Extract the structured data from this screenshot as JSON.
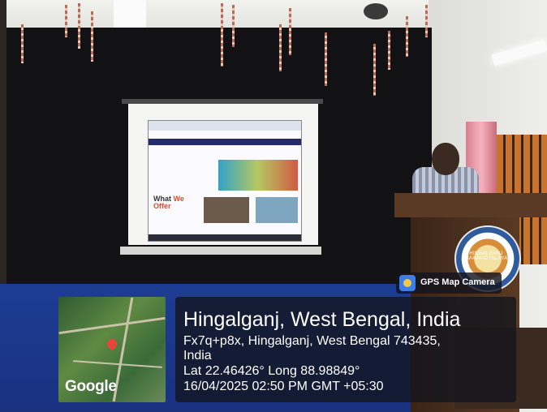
{
  "gps_overlay": {
    "badge_label": "GPS Map Camera",
    "map_provider": "Google",
    "location_title": "Hingalganj, West Bengal, India",
    "address_line_1": "Fx7q+p8x, Hingalganj, West Bengal 743435,",
    "address_line_2": "India",
    "coordinates": "Lat 22.46426° Long 88.98849°",
    "datetime": "16/04/2025 02:50 PM GMT +05:30"
  },
  "projected_slide": {
    "heading_plain": "What",
    "heading_accent": "We",
    "heading_line2": "Offer"
  },
  "podium": {
    "emblem_text": "HINGALGANJ MAHAVIDYALAYA"
  },
  "colors": {
    "floor_blue": "#1c3c93",
    "overlay_panel": "#12141e",
    "map_pin_red": "#e8443a"
  }
}
